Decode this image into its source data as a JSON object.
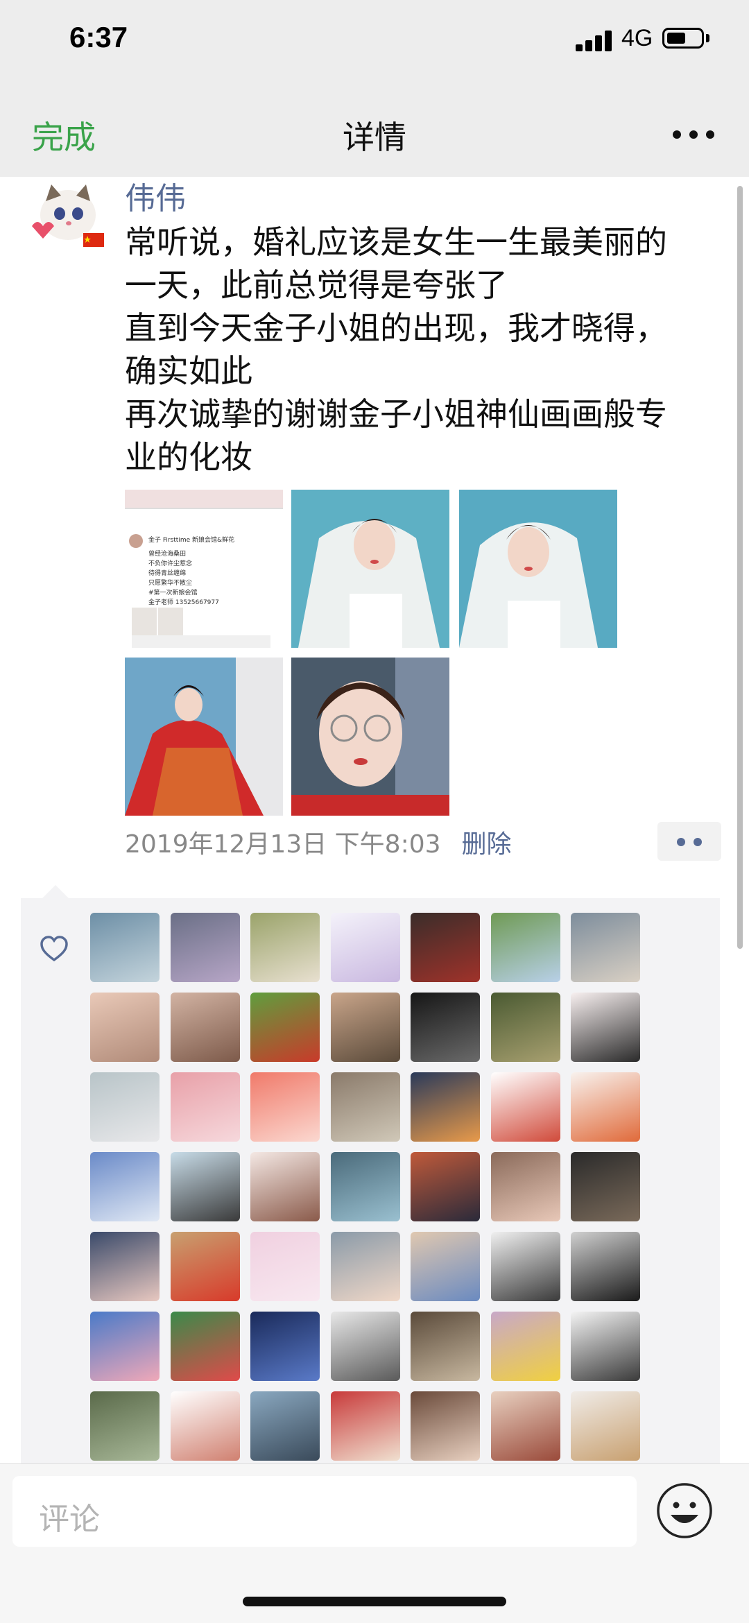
{
  "status_bar": {
    "time": "6:37",
    "network": "4G"
  },
  "nav": {
    "done_label": "完成",
    "title": "详情",
    "more_icon": "more-dots-icon"
  },
  "post": {
    "username": "伟伟",
    "lines": [
      "常听说，婚礼应该是女生一生最美丽的",
      "一天，此前总觉得是夸张了",
      "直到今天金子小姐的出现，我才晓得，",
      "确实如此",
      "再次诚挚的谢谢金子小姐神仙画画般专",
      "业的化妆"
    ],
    "photos": [
      {
        "desc": "screenshot-collage"
      },
      {
        "desc": "bride-white-veil"
      },
      {
        "desc": "bride-white-veil-2"
      },
      {
        "desc": "bride-red-gown"
      },
      {
        "desc": "woman-glasses"
      }
    ],
    "screenshot_photo_text": {
      "line1": "金子 Firsttime 新娘会馆&鲜花",
      "line2": "曾经沧海桑田",
      "line3": "不负你许尘惹念",
      "line4": "待得青丝缠绵",
      "line5": "只愿繁华不散尘",
      "line6": "#第一次新娘会馆",
      "line7": "金子老师 13525667977"
    },
    "timestamp": "2019年12月13日 下午8:03",
    "delete_label": "删除"
  },
  "likes": {
    "heart_icon": "heart-outline-icon",
    "avatars": [
      {
        "c1": "#6d8fa6",
        "c2": "#c4d4dc"
      },
      {
        "c1": "#6a6f86",
        "c2": "#b7a6c7"
      },
      {
        "c1": "#9aa36a",
        "c2": "#e8e0d0"
      },
      {
        "c1": "#f4f2fa",
        "c2": "#c9b8e0"
      },
      {
        "c1": "#3a2d2a",
        "c2": "#a0322a"
      },
      {
        "c1": "#6f9a54",
        "c2": "#b8d0e8"
      },
      {
        "c1": "#7d8d9c",
        "c2": "#d9d0c4"
      },
      {
        "c1": "#e9c9b8",
        "c2": "#b08a78"
      },
      {
        "c1": "#d2b3a3",
        "c2": "#7d5a4a"
      },
      {
        "c1": "#5f9e3e",
        "c2": "#c93a2a"
      },
      {
        "c1": "#c9a58a",
        "c2": "#5a4a3a"
      },
      {
        "c1": "#161616",
        "c2": "#6a6a6a"
      },
      {
        "c1": "#4a5a32",
        "c2": "#a8a070"
      },
      {
        "c1": "#f8f0f0",
        "c2": "#2a2a2a"
      },
      {
        "c1": "#b8c4c8",
        "c2": "#e8e8ea"
      },
      {
        "c1": "#e8a0a8",
        "c2": "#f6d8dc"
      },
      {
        "c1": "#f07a6a",
        "c2": "#fbd8d0"
      },
      {
        "c1": "#8a7a6a",
        "c2": "#d0c8b8"
      },
      {
        "c1": "#2a3a5a",
        "c2": "#e89a4a"
      },
      {
        "c1": "#ffffff",
        "c2": "#d04a3a"
      },
      {
        "c1": "#f8f2ee",
        "c2": "#e06a3a"
      },
      {
        "c1": "#6a8ac8",
        "c2": "#e0e8f4"
      },
      {
        "c1": "#c8dce8",
        "c2": "#3a3a3a"
      },
      {
        "c1": "#f4e8e4",
        "c2": "#8a5a4a"
      },
      {
        "c1": "#4a6a7a",
        "c2": "#9ac0d0"
      },
      {
        "c1": "#c05a3a",
        "c2": "#2a2a3a"
      },
      {
        "c1": "#8a6a5a",
        "c2": "#e8c8b8"
      },
      {
        "c1": "#2a2a2a",
        "c2": "#7a6a5a"
      },
      {
        "c1": "#3a4a6a",
        "c2": "#e8c8c0"
      },
      {
        "c1": "#c8a070",
        "c2": "#d83a2a"
      },
      {
        "c1": "#f0d0e0",
        "c2": "#f8e8f0"
      },
      {
        "c1": "#8a9aa8",
        "c2": "#f0d8c8"
      },
      {
        "c1": "#e0c8b0",
        "c2": "#6a8ac0"
      },
      {
        "c1": "#f0f0f0",
        "c2": "#3a3a3a"
      },
      {
        "c1": "#d0d0d0",
        "c2": "#1a1a1a"
      },
      {
        "c1": "#4a7ac8",
        "c2": "#f0a8b8"
      },
      {
        "c1": "#3a8a4a",
        "c2": "#e04a4a"
      },
      {
        "c1": "#1a2a5a",
        "c2": "#5a7ac8"
      },
      {
        "c1": "#e8e8e8",
        "c2": "#5a5a5a"
      },
      {
        "c1": "#5a4a3a",
        "c2": "#c8b8a0"
      },
      {
        "c1": "#c8a8c8",
        "c2": "#f0d040"
      },
      {
        "c1": "#f4f4f4",
        "c2": "#3a3a3a"
      },
      {
        "c1": "#5a6a4a",
        "c2": "#a8b898"
      },
      {
        "c1": "#ffffff",
        "c2": "#d08070"
      },
      {
        "c1": "#8aa8c0",
        "c2": "#3a4a5a"
      },
      {
        "c1": "#c83a3a",
        "c2": "#f0e0d0"
      },
      {
        "c1": "#6a4a3a",
        "c2": "#e8d0c0"
      },
      {
        "c1": "#e8d0c0",
        "c2": "#9a4a3a"
      },
      {
        "c1": "#f0ece8",
        "c2": "#c8a070"
      }
    ]
  },
  "comment_bar": {
    "placeholder": "评论",
    "emoji_icon": "emoji-face-icon"
  }
}
